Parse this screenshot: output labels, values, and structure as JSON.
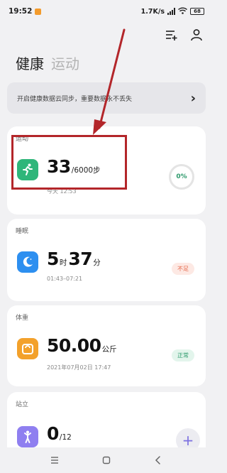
{
  "status_bar": {
    "time": "19:52",
    "network_speed": "1.7K/s",
    "battery": "68"
  },
  "header": {
    "tabs": [
      {
        "label": "健康"
      },
      {
        "label": "运动"
      }
    ]
  },
  "sync_banner": {
    "text": "开启健康数据云同步，重要数据永不丢失"
  },
  "exercise": {
    "title": "运动",
    "steps": "33",
    "goal": "/6000步",
    "time": "今天 12:53",
    "progress": "0%",
    "progress_fraction": 0
  },
  "sleep": {
    "title": "睡眠",
    "hours": "5",
    "hours_unit": "时",
    "minutes": "37",
    "minutes_unit": "分",
    "range": "01:43–07:21",
    "status": "不足"
  },
  "weight": {
    "title": "体重",
    "value": "50.00",
    "unit": "公斤",
    "date": "2021年07月02日 17:47",
    "status": "正常"
  },
  "standing": {
    "title": "站立",
    "value": "0",
    "total": "/12"
  },
  "colors": {
    "exercise_green": "#2fb67a",
    "sleep_blue": "#2d8ff0",
    "weight_orange": "#f3a12b",
    "standing_purple": "#8f7ff0",
    "annotation_red": "#b3262a"
  }
}
